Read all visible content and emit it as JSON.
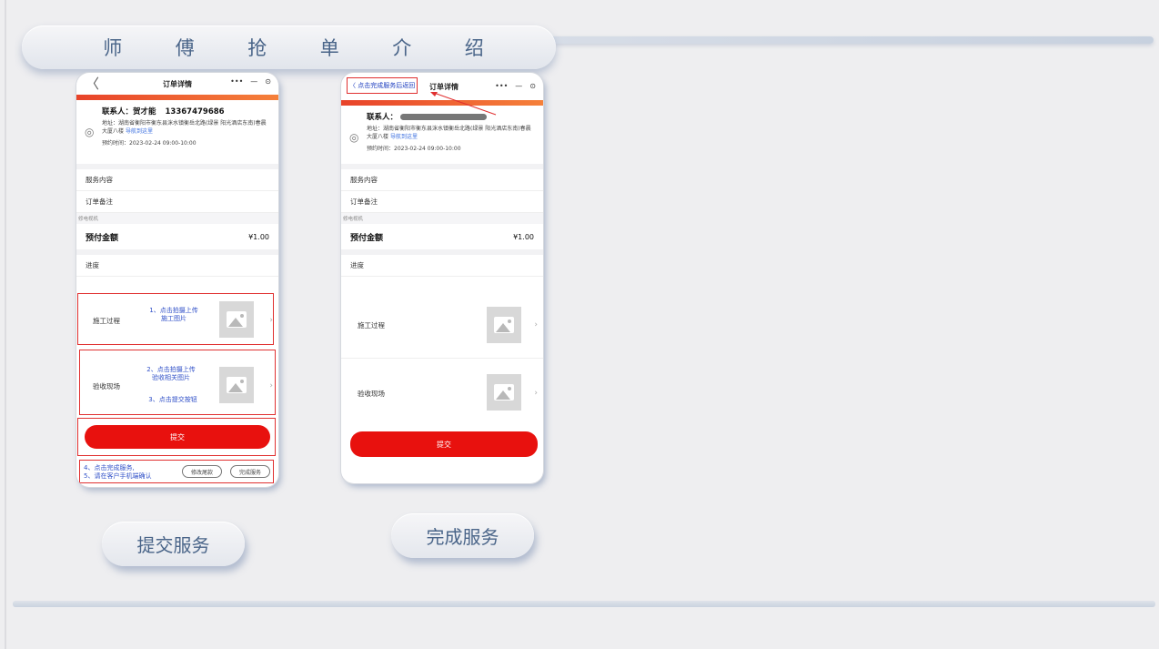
{
  "title_chars": [
    "师",
    "傅",
    "抢",
    "单",
    "介",
    "绍"
  ],
  "phone_left": {
    "back_glyph": "〈",
    "title": "订单详情",
    "capsule": [
      "•••",
      "—",
      "⊙"
    ],
    "contact_label": "联系人：贺才能",
    "contact_phone": "13367479686",
    "address": "地址：湖南省衡阳市衡东县洣水镇衡岳北路(绿景 阳光酒店东南)春晨大厦八楼",
    "nav_link": "导航到这里",
    "appoint_time": "预约时间：2023-02-24 09:00-10:00",
    "service_content": "服务内容",
    "order_note": "订单备注",
    "small_label": "修电视机",
    "prepay_label": "预付金额",
    "prepay_value": "¥1.00",
    "progress": "进度",
    "construction": "施工过程",
    "acceptance": "验收现场",
    "hint1": "1、点击拍摄上传\n施工图片",
    "hint2": "2、点击拍摄上传\n验收相关图片",
    "hint3": "3、点击提交按钮",
    "hint4": "4、点击完成服务,\n5、请在客户手机端确认",
    "submit": "提交",
    "modify_price": "修改尾款",
    "complete_service": "完成服务"
  },
  "phone_right": {
    "back_hint": "〈 点击完成服务后返回",
    "title": "订单详情",
    "capsule": [
      "•••",
      "—",
      "⊙"
    ],
    "contact_label": "联系人：",
    "address": "地址：湖南省衡阳市衡东县洣水镇衡岳北路(绿景 阳光酒店东南)春晨大厦八楼",
    "nav_link": "导航到这里",
    "appoint_time": "预约时间：2023-02-24 09:00-10:00",
    "service_content": "服务内容",
    "order_note": "订单备注",
    "small_label": "修电视机",
    "prepay_label": "预付金额",
    "prepay_value": "¥1.00",
    "progress": "进度",
    "construction": "施工过程",
    "acceptance": "验收现场",
    "submit": "提交"
  },
  "caption_left": "提交服务",
  "caption_right": "完成服务",
  "colors": {
    "accent_red": "#e8110e",
    "hint_blue": "#3050c8",
    "title_blue": "#4a6589"
  }
}
